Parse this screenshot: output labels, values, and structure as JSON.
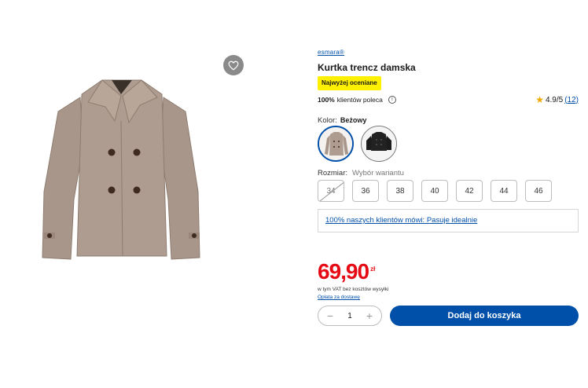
{
  "product": {
    "brand": "esmara®",
    "title": "Kurtka trencz damska",
    "badge": "Najwyżej oceniane",
    "recommend_percent": "100%",
    "recommend_text": "klientów poleca",
    "rating": "4.9/5",
    "rating_count": "(12)"
  },
  "color": {
    "label": "Kolor:",
    "selected": "Beżowy",
    "options": [
      "Beżowy",
      "Czarny"
    ],
    "colors": {
      "beige": "#a9978a",
      "black": "#1c1c1c"
    }
  },
  "size": {
    "label": "Rozmiar:",
    "hint": "Wybór wariantu",
    "options": [
      "34",
      "36",
      "38",
      "40",
      "42",
      "44",
      "46"
    ],
    "unavailable": [
      "34"
    ]
  },
  "fit_note": "100% naszych klientów mówi: Pasuje idealnie",
  "price": {
    "value": "69,90",
    "currency": "zł",
    "vat_note": "w tym VAT bez kosztów wysyłki",
    "delivery_link": "Opłata za dostawę"
  },
  "cart": {
    "quantity": "1",
    "add_label": "Dodaj do koszyka"
  },
  "icons": {
    "favorite": "heart-icon",
    "info": "info-icon",
    "star": "star-icon",
    "minus": "minus-icon",
    "plus": "plus-icon"
  },
  "theme": {
    "accent": "#0050aa",
    "price": "#e60a14",
    "badge": "#fff000",
    "star": "#f0a800"
  }
}
